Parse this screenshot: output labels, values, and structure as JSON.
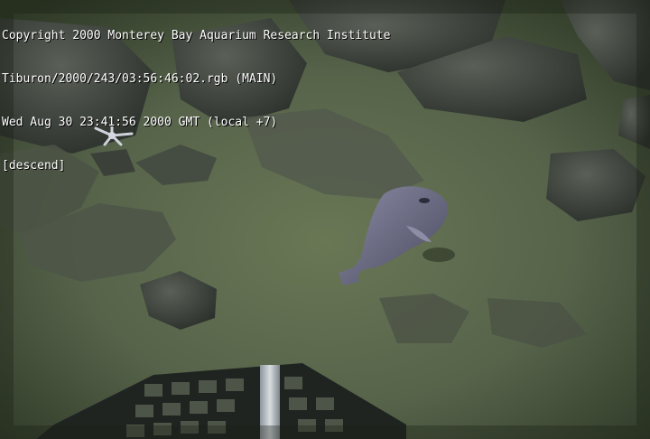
{
  "overlay": {
    "copyright": "Copyright 2000 Monterey Bay Aquarium Research Institute",
    "frame_id": "Tiburon/2000/243/03:56:46:02.rgb (MAIN)",
    "timestamp": "Wed Aug 30 23:41:56 2000 GMT (local +7)",
    "status": "[descend]"
  },
  "colors": {
    "sediment": "#5c6a4a",
    "sediment_dark": "#3a4630",
    "rock": "#4a4f48",
    "rock_dark": "#2f3430",
    "fish": "#6f6f86",
    "vignette": "#1e2518"
  },
  "scene": {
    "subjects": [
      "fish",
      "seafloor-rocks",
      "brittle-star",
      "sampling-basket"
    ]
  }
}
